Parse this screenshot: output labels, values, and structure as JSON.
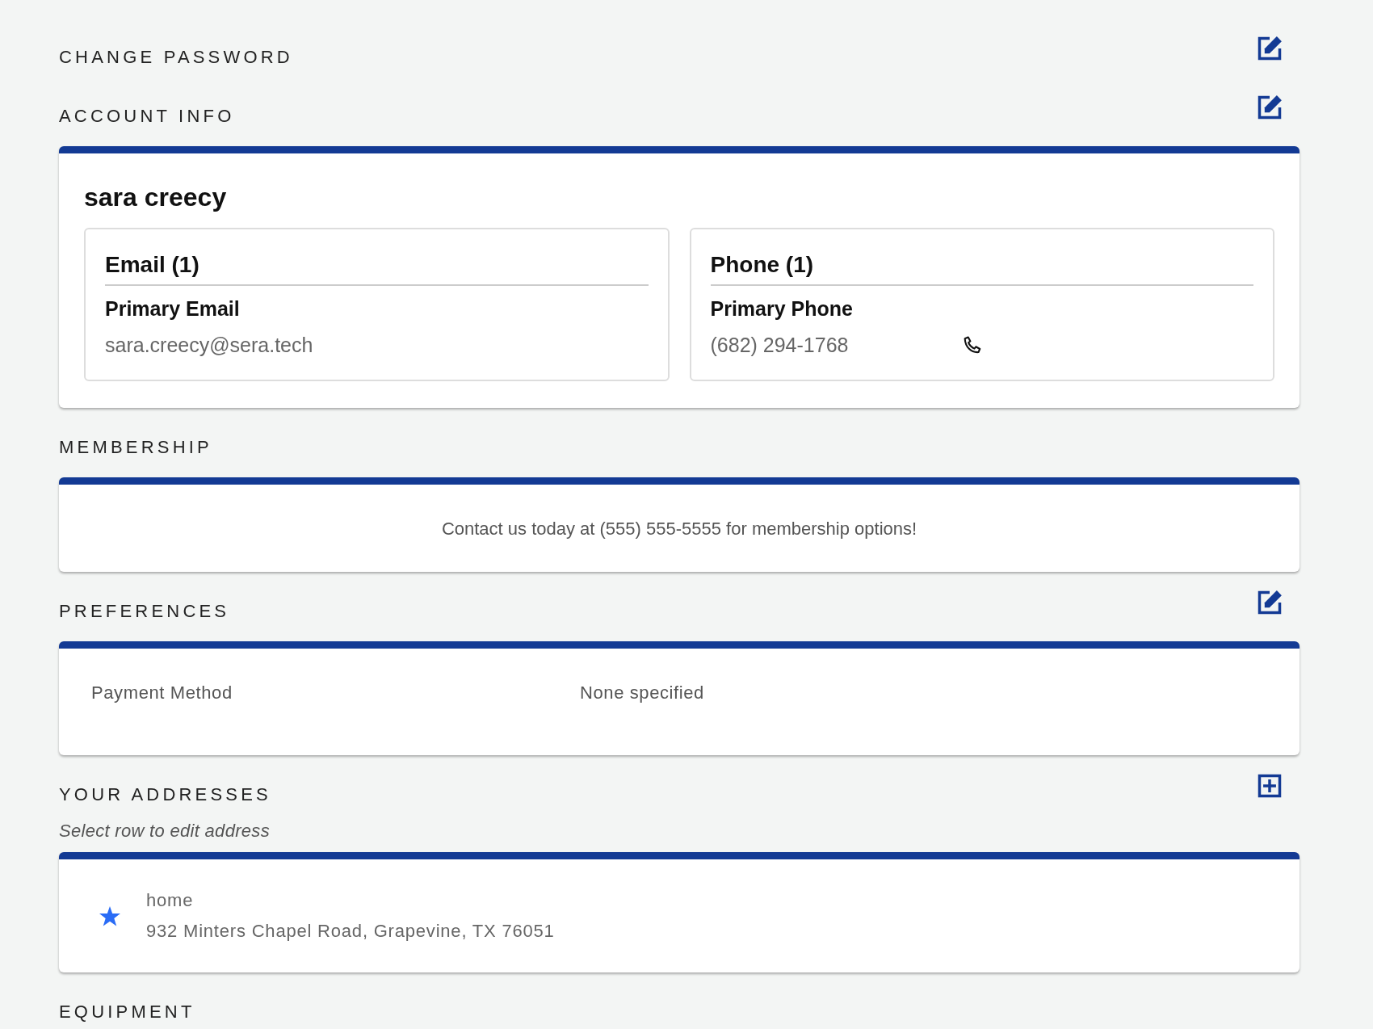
{
  "sections": [
    {
      "kind": "header",
      "title": "CHANGE PASSWORD",
      "edit_action": true
    },
    {
      "kind": "account",
      "title": "ACCOUNT INFO",
      "edit_action": true,
      "name": "sara creecy",
      "contact_boxes": [
        {
          "kind": "email",
          "heading": "Email (1)",
          "label": "Primary Email",
          "value": "sara.creecy@sera.tech"
        },
        {
          "kind": "phone",
          "heading": "Phone (1)",
          "label": "Primary Phone",
          "value": "(682) 294-1768"
        }
      ]
    },
    {
      "kind": "message",
      "title": "MEMBERSHIP",
      "message": "Contact us today at (555) 555-5555 for membership options!"
    },
    {
      "kind": "preferences",
      "title": "PREFERENCES",
      "edit_action": true,
      "rows": [
        {
          "label": "Payment Method",
          "value": "None specified"
        }
      ]
    },
    {
      "kind": "addresses",
      "title": "YOUR ADDRESSES",
      "add_action": true,
      "hint": "Select row to edit address",
      "addresses": [
        {
          "default": true,
          "name": "home",
          "address": "932 Minters Chapel Road, Grapevine, TX 76051"
        }
      ]
    },
    {
      "kind": "header",
      "title": "EQUIPMENT"
    }
  ]
}
